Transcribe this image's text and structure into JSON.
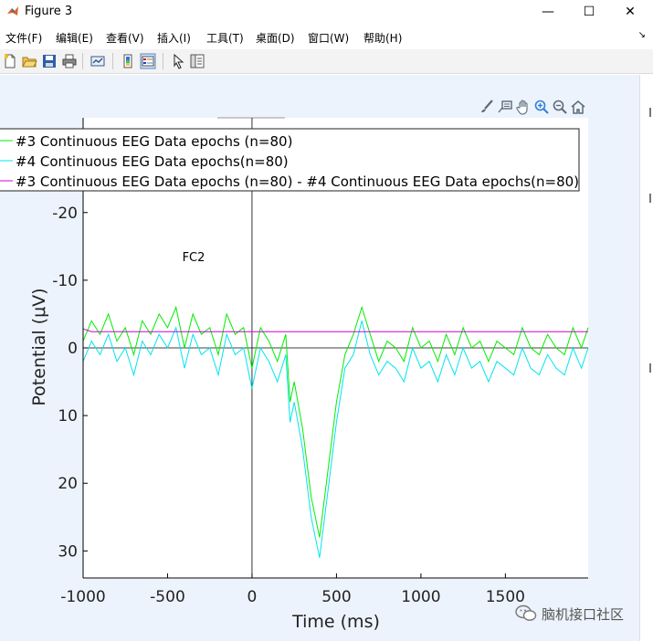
{
  "window": {
    "title": "Figure 3",
    "minimize_glyph": "—",
    "maximize_glyph": "☐",
    "close_glyph": "✕",
    "icon": "matlab-icon"
  },
  "menu": {
    "items": [
      {
        "label": "文件(F)"
      },
      {
        "label": "编辑(E)"
      },
      {
        "label": "查看(V)"
      },
      {
        "label": "插入(I)"
      },
      {
        "label": "工具(T)"
      },
      {
        "label": "桌面(D)"
      },
      {
        "label": "窗口(W)"
      },
      {
        "label": "帮助(H)"
      }
    ],
    "overflow_glyph": "↘"
  },
  "toolbar": {
    "icons": [
      "new-figure-icon",
      "open-icon",
      "save-icon",
      "print-icon",
      "link-plot-icon",
      "colorbar-icon",
      "legend-icon",
      "pointer-icon",
      "property-editor-icon"
    ]
  },
  "axes_toolbar": {
    "icons": [
      "brush-icon",
      "datatip-icon",
      "pan-icon",
      "zoom-in-icon",
      "zoom-out-icon",
      "home-icon"
    ]
  },
  "colors": {
    "series3": "#00ee00",
    "series4": "#00e5ee",
    "difference": "#d400d4",
    "figure_bg": "#edf3fc"
  },
  "chart_data": {
    "type": "line",
    "channel_label": "FC2",
    "xlabel": "Time (ms)",
    "ylabel": "Potential (μV)",
    "xlim": [
      -1000,
      1990
    ],
    "ylim": [
      -34,
      34
    ],
    "y_reversed": true,
    "x_ticks": [
      -1000,
      -500,
      0,
      500,
      1000,
      1500
    ],
    "y_ticks": [
      -20,
      -10,
      0,
      10,
      20,
      30
    ],
    "x_tick_labels": [
      "-1000",
      "-500",
      "0",
      "500",
      "1000",
      "1500"
    ],
    "y_tick_labels": [
      "-20",
      "-10",
      "0",
      "10",
      "20",
      "30"
    ],
    "legend_position": "top-left",
    "series": [
      {
        "name": "#3 Continuous EEG Data epochs (n=80)",
        "color": "#00ee00",
        "x": [
          -1000,
          -950,
          -900,
          -850,
          -800,
          -750,
          -700,
          -650,
          -600,
          -550,
          -500,
          -450,
          -400,
          -350,
          -300,
          -250,
          -200,
          -150,
          -100,
          -50,
          0,
          50,
          100,
          150,
          200,
          225,
          250,
          300,
          350,
          400,
          450,
          500,
          550,
          600,
          650,
          700,
          750,
          800,
          850,
          900,
          950,
          1000,
          1050,
          1100,
          1150,
          1200,
          1250,
          1300,
          1350,
          1400,
          1450,
          1500,
          1550,
          1600,
          1650,
          1700,
          1750,
          1800,
          1850,
          1900,
          1950,
          1990
        ],
        "y": [
          -1,
          -4,
          -2,
          -5,
          -1,
          -3,
          1,
          -4,
          -2,
          -5,
          -3,
          -6,
          0,
          -5,
          -2,
          -3,
          1,
          -5,
          -2,
          -3,
          3,
          -3,
          -1,
          2,
          -2,
          8,
          5,
          12,
          22,
          28,
          18,
          8,
          1,
          -2,
          -6,
          -2,
          2,
          -1,
          0,
          2,
          -3,
          0,
          -1,
          2,
          -2,
          1,
          -3,
          0,
          -1,
          2,
          -1,
          0,
          1,
          -3,
          0,
          1,
          -2,
          0,
          1,
          -3,
          0,
          -3
        ]
      },
      {
        "name": "#4 Continuous EEG Data epochs(n=80)",
        "color": "#00e5ee",
        "x": [
          -1000,
          -950,
          -900,
          -850,
          -800,
          -750,
          -700,
          -650,
          -600,
          -550,
          -500,
          -450,
          -400,
          -350,
          -300,
          -250,
          -200,
          -150,
          -100,
          -50,
          0,
          50,
          100,
          150,
          200,
          225,
          250,
          300,
          350,
          400,
          450,
          500,
          550,
          600,
          650,
          700,
          750,
          800,
          850,
          900,
          950,
          1000,
          1050,
          1100,
          1150,
          1200,
          1250,
          1300,
          1350,
          1400,
          1450,
          1500,
          1550,
          1600,
          1650,
          1700,
          1750,
          1800,
          1850,
          1900,
          1950,
          1990
        ],
        "y": [
          2,
          -1,
          1,
          -2,
          2,
          0,
          4,
          -1,
          1,
          -2,
          0,
          -3,
          3,
          -2,
          1,
          0,
          4,
          -2,
          1,
          0,
          6,
          0,
          2,
          5,
          1,
          11,
          8,
          15,
          25,
          31,
          21,
          11,
          3,
          1,
          -4,
          1,
          4,
          2,
          3,
          5,
          0,
          3,
          2,
          5,
          1,
          4,
          0,
          3,
          2,
          5,
          2,
          3,
          4,
          0,
          3,
          4,
          1,
          3,
          4,
          0,
          3,
          0
        ]
      },
      {
        "name": "#3 Continuous EEG Data epochs (n=80) - #4 Continuous EEG Data epochs(n=80)",
        "color": "#d400d4",
        "x": [
          -1000,
          -950,
          1990
        ],
        "y": [
          -2.8,
          -2.4,
          -2.4
        ]
      }
    ]
  },
  "watermark": {
    "text": "脑机接口社区"
  }
}
